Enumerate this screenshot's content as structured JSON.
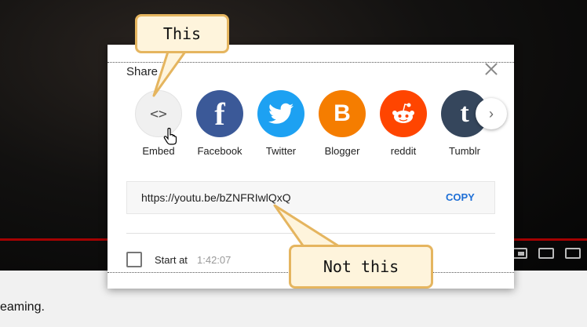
{
  "background": {
    "below_text": "eaming."
  },
  "dialog": {
    "title": "Share",
    "close_icon": "close-icon",
    "targets": [
      {
        "label": "Embed",
        "icon": "<>",
        "color": "#f0f0f0"
      },
      {
        "label": "Facebook",
        "icon": "f",
        "color": "#3b5998"
      },
      {
        "label": "Twitter",
        "icon": "twitter-bird-icon",
        "color": "#1da1f2"
      },
      {
        "label": "Blogger",
        "icon": "B",
        "color": "#f57d00"
      },
      {
        "label": "reddit",
        "icon": "reddit-alien-icon",
        "color": "#ff4500"
      },
      {
        "label": "Tumblr",
        "icon": "t",
        "color": "#35465c"
      }
    ],
    "next_icon": "chevron-right-icon",
    "url": "https://youtu.be/bZNFRIwlQxQ",
    "copy_label": "COPY",
    "start_at_label": "Start at",
    "start_at_time": "1:42:07"
  },
  "annotations": {
    "this_label": "This",
    "not_this_label": "Not this",
    "color_fill": "#fef4dc",
    "color_border": "#e5b55f"
  }
}
